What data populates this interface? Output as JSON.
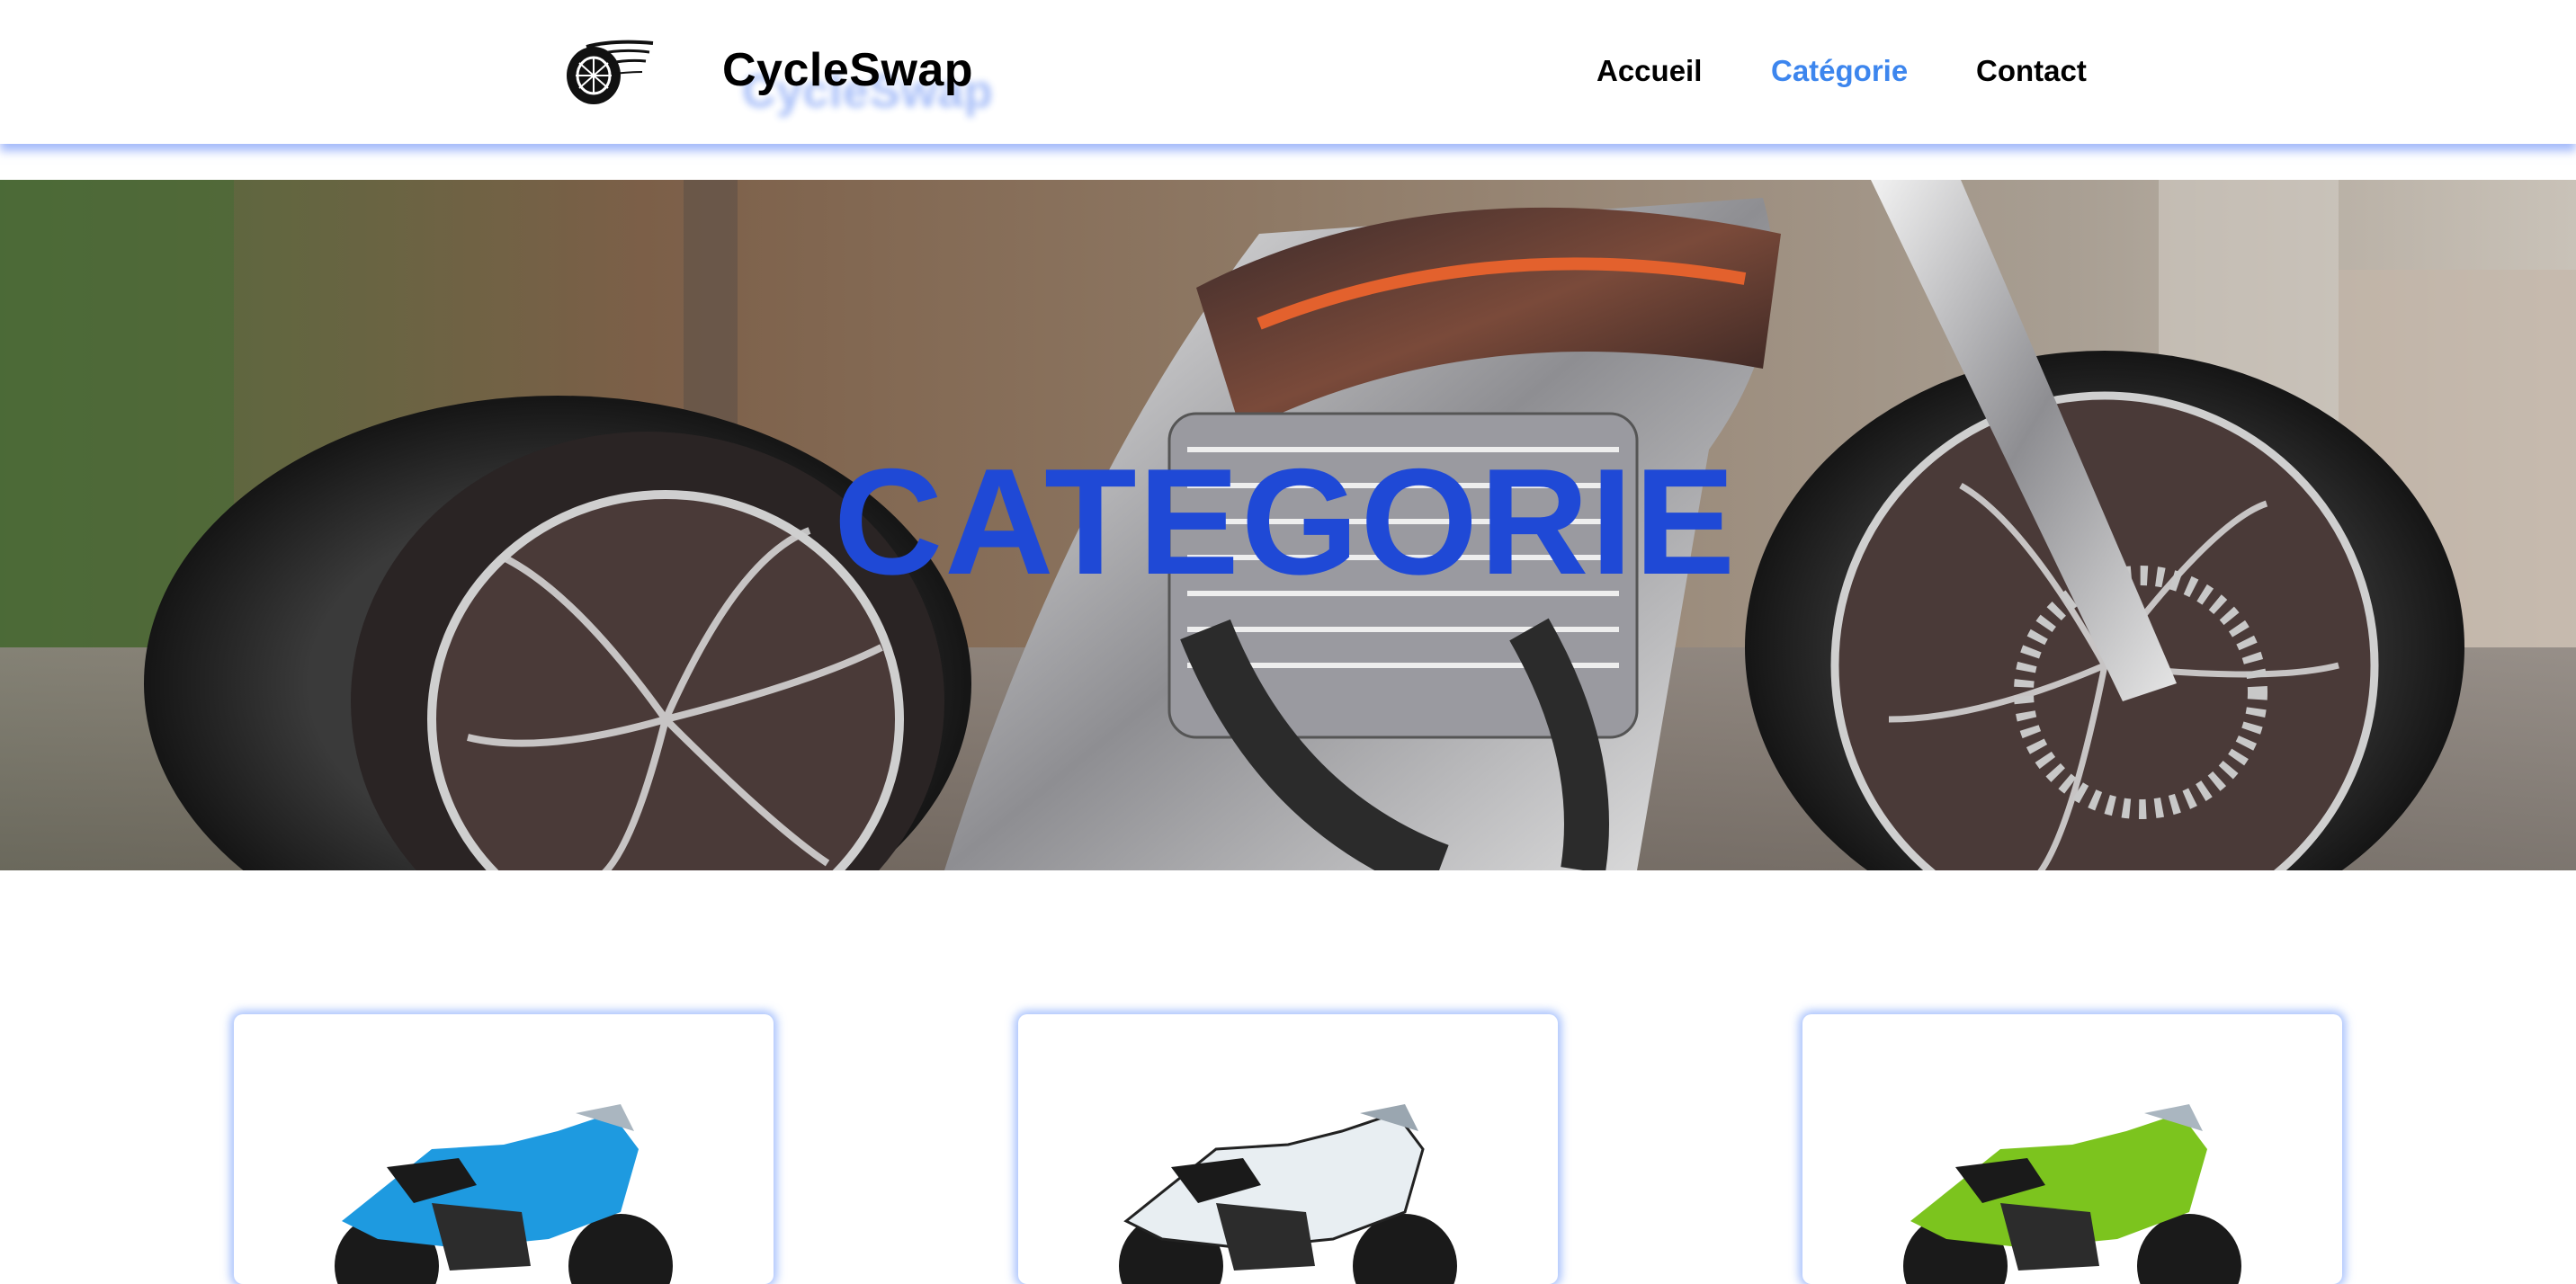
{
  "header": {
    "brand": "CycleSwap",
    "logo_icon": "motorcycle-wheel-logo-icon",
    "nav": [
      {
        "label": "Accueil",
        "active": false
      },
      {
        "label": "Catégorie",
        "active": true
      },
      {
        "label": "Contact",
        "active": false
      }
    ],
    "active_color": "#3d86ee"
  },
  "hero": {
    "title": "CATEGORIE",
    "title_color": "#1f49d6",
    "image": "custom-chopper-motorcycle-photo"
  },
  "cards": [
    {
      "image": "blue-sport-motorcycle-photo",
      "color": "#1e9ae0"
    },
    {
      "image": "white-sport-motorcycle-photo",
      "color": "#e8eef2"
    },
    {
      "image": "green-sport-motorcycle-photo",
      "color": "#7cc41e"
    }
  ],
  "accent_shadow": "#5c8cfa"
}
